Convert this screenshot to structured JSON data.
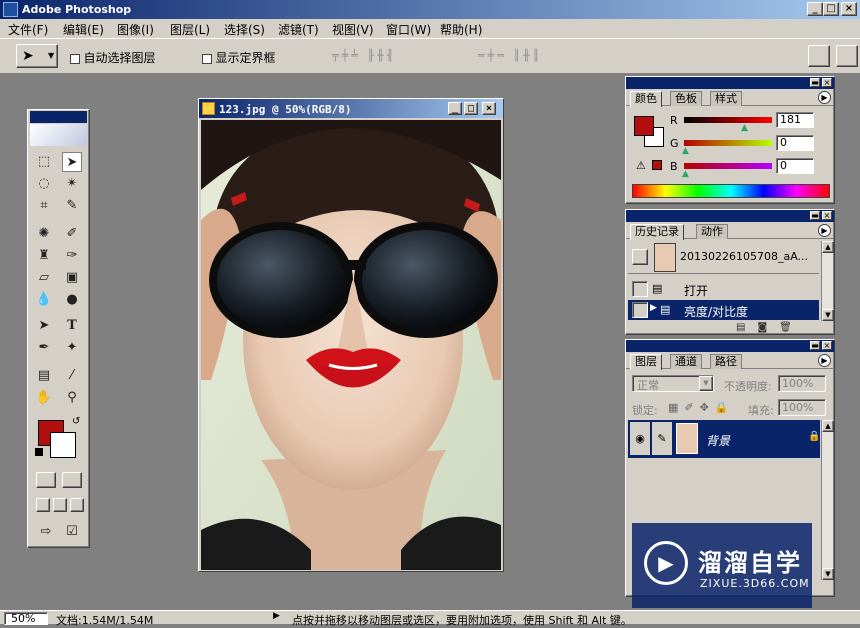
{
  "app": {
    "title": "Adobe Photoshop"
  },
  "menu": [
    "文件(F)",
    "编辑(E)",
    "图像(I)",
    "图层(L)",
    "选择(S)",
    "滤镜(T)",
    "视图(V)",
    "窗口(W)",
    "帮助(H)"
  ],
  "options": {
    "auto_select": "自动选择图层",
    "show_bounds": "显示定界框"
  },
  "document": {
    "title": "123.jpg @ 50%(RGB/8)"
  },
  "colors": {
    "fg": "#b40f0f",
    "bg": "#ffffff",
    "accent": "#0a246a",
    "chrome": "#d4d0c8",
    "workspace": "#808080"
  },
  "color_panel": {
    "tabs": [
      "颜色",
      "色板",
      "样式"
    ],
    "r_label": "R",
    "g_label": "G",
    "b_label": "B",
    "r": "181",
    "g": "0",
    "b": "0"
  },
  "history_panel": {
    "tabs": [
      "历史记录",
      "动作"
    ],
    "snapshot": "20130226105708_aA...",
    "items": [
      "打开",
      "亮度/对比度"
    ]
  },
  "layers_panel": {
    "tabs": [
      "图层",
      "通道",
      "路径"
    ],
    "blend_mode": "正常",
    "opacity_label": "不透明度:",
    "opacity": "100%",
    "lock_label": "锁定:",
    "fill_label": "填充:",
    "fill": "100%",
    "layer_name": "背景"
  },
  "status": {
    "zoom": "50%",
    "doc": "文档:1.54M/1.54M",
    "hint": "点按并拖移以移动图层或选区，要用附加选项，使用 Shift 和 Alt 键。"
  },
  "watermark": {
    "cn": "溜溜自学",
    "url": "ZIXUE.3D66.COM"
  }
}
